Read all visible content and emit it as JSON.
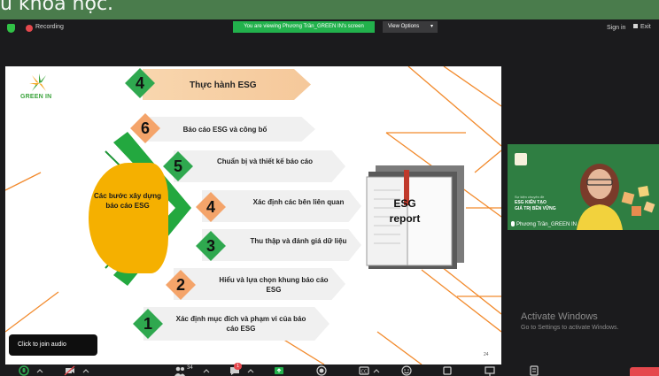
{
  "caption": "u khoá học.",
  "zoom": {
    "recording_label": "Recording",
    "viewing_banner": "You are viewing Phương Trần_GREEN IN's screen",
    "view_options_label": "View Options",
    "sign_in_label": "Sign in",
    "exit_fullscreen_label": "Exit"
  },
  "slide": {
    "logo_text": "GREEN IN",
    "banner_number": "4",
    "banner_title": "Thực hành ESG",
    "center_label": "Các bước xây dựng báo cáo ESG",
    "steps": [
      {
        "number": "6",
        "label": "Báo cáo ESG và công bố",
        "style": "orange"
      },
      {
        "number": "5",
        "label": "Chuẩn bị và thiết kế báo cáo",
        "style": "green"
      },
      {
        "number": "4",
        "label": "Xác định các bên liên quan",
        "style": "orange"
      },
      {
        "number": "3",
        "label": "Thu thập và đánh giá dữ liệu",
        "style": "green"
      },
      {
        "number": "2",
        "label": "Hiểu và lựa chọn khung báo cáo ESG",
        "style": "orange"
      },
      {
        "number": "1",
        "label": "Xác định mục đích và phạm vi của báo cáo ESG",
        "style": "green"
      }
    ],
    "book_label": "ESG report",
    "page_number": "24"
  },
  "participant": {
    "caption_small": "Sự kiện chuyên đề",
    "caption_line1": "ESG KIẾN TẠO",
    "caption_line2": "GIÁ TRỊ BỀN VỮNG",
    "name": "Phương Trần_GREEN IN"
  },
  "windows_watermark": {
    "title": "Activate Windows",
    "subtitle": "Go to Settings to activate Windows."
  },
  "tooltip": "Click to join audio",
  "toolbar": {
    "participants_count": "34",
    "chat_badge": "1"
  },
  "colors": {
    "green": "#2fa84f",
    "orange": "#f4a46a",
    "yellow": "#f5b000",
    "record_red": "#e5484d",
    "viewing_green": "#22b14c"
  }
}
